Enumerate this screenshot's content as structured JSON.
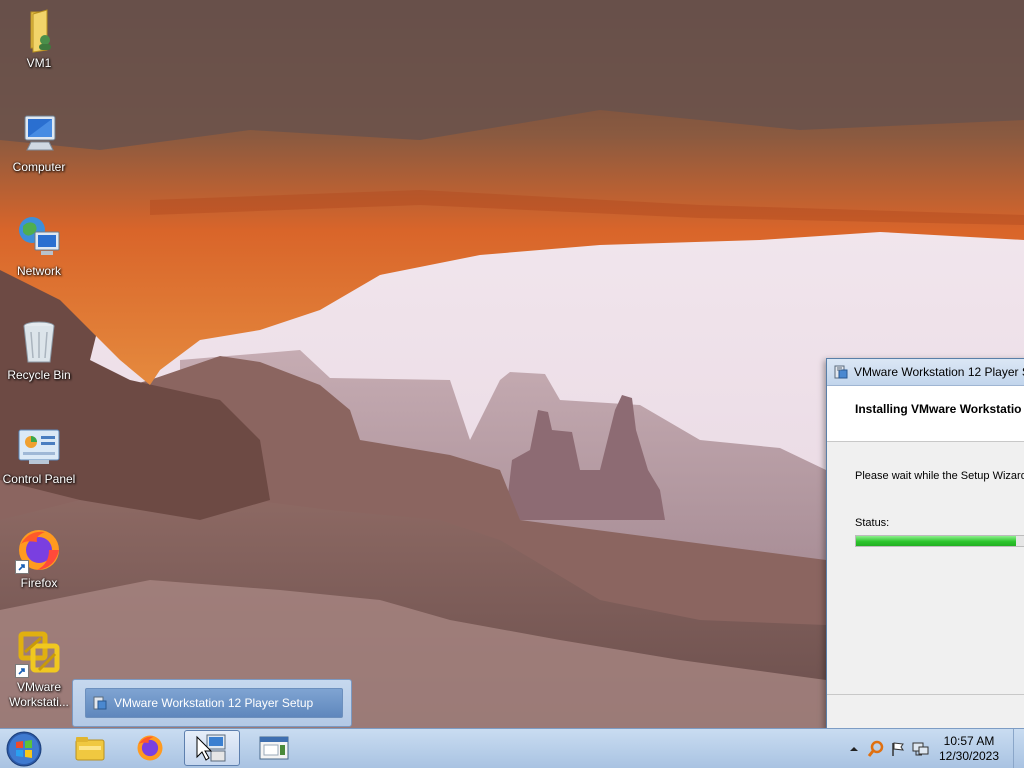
{
  "desktop": {
    "icons": [
      {
        "label": "VM1",
        "icon": "folder-user-icon"
      },
      {
        "label": "Computer",
        "icon": "computer-icon"
      },
      {
        "label": "Network",
        "icon": "network-icon"
      },
      {
        "label": "Recycle Bin",
        "icon": "recycle-bin-icon"
      },
      {
        "label": "Control Panel",
        "icon": "control-panel-icon"
      },
      {
        "label": "Firefox",
        "icon": "firefox-icon"
      },
      {
        "label": "VMware Workstati...",
        "icon": "vmware-icon"
      }
    ]
  },
  "setup_window": {
    "title": "VMware Workstation 12 Player Se",
    "header": "Installing VMware Workstatio",
    "message": "Please wait while the Setup Wizard",
    "status_label": "Status:",
    "progress": 0.85
  },
  "taskbar": {
    "thumbnail_label": "VMware Workstation 12 Player Setup",
    "pinned": [
      "start-orb",
      "explorer-icon",
      "firefox-icon",
      "vmware-setup-icon",
      "window-icon"
    ],
    "clock_time": "10:57 AM",
    "clock_date": "12/30/2023"
  },
  "colors": {
    "progress": "#2cc52c",
    "taskbar": "#b8cfe9"
  }
}
